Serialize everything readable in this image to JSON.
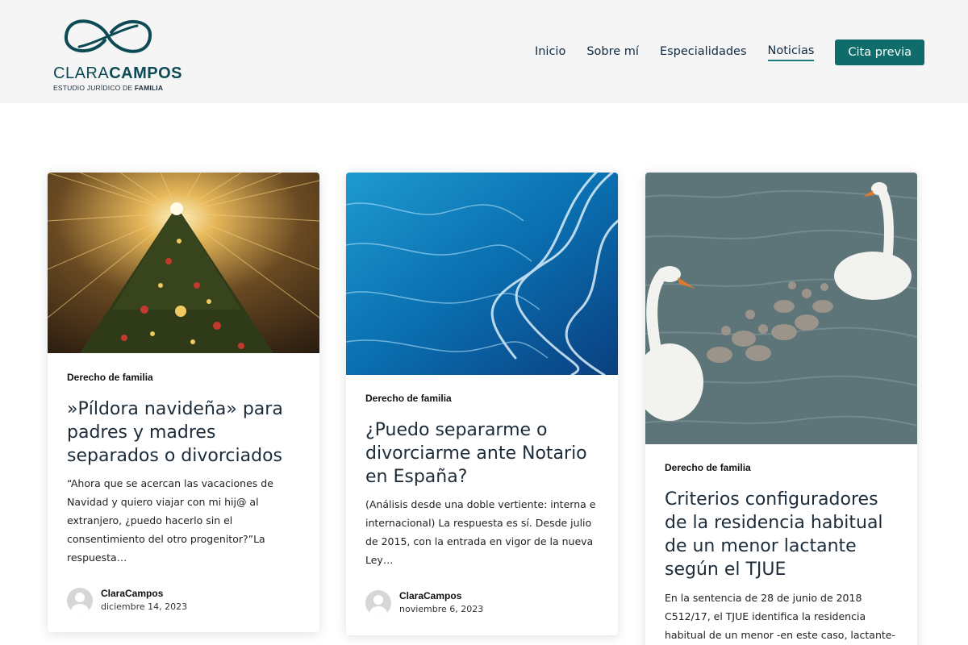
{
  "brand": {
    "name_light": "CLARA",
    "name_bold": "CAMPOS",
    "tagline_light": "ESTUDIO JURÍDICO DE ",
    "tagline_bold": "FAMILIA",
    "color": "#0d4a55"
  },
  "nav": {
    "items": [
      {
        "label": "Inicio"
      },
      {
        "label": "Sobre mí"
      },
      {
        "label": "Especialidades"
      },
      {
        "label": "Noticias"
      }
    ],
    "active": "Noticias",
    "cta_label": "Cita previa",
    "cta_color": "#106b6b"
  },
  "posts": [
    {
      "image": "christmas-tree-lights",
      "category": "Derecho de familia",
      "title": "»Píldora navideña» para padres y madres separados o divorciados",
      "excerpt": "“Ahora que se acercan las vacaciones de Navidad y quiero viajar con mi hij@ al extranjero, ¿puedo hacerlo sin el consentimiento del otro progenitor?”La respuesta…",
      "author": "ClaraCampos",
      "date": "diciembre 14, 2023"
    },
    {
      "image": "ocean-waves",
      "category": "Derecho de familia",
      "title": "¿Puedo separarme o divorciarme ante Notario en España?",
      "excerpt": "(Análisis desde una doble vertiente: interna e internacional) La respuesta es sí. Desde julio de 2015, con la entrada en vigor de la nueva Ley…",
      "author": "ClaraCampos",
      "date": "noviembre 6, 2023"
    },
    {
      "image": "swans-with-cygnets",
      "category": "Derecho de familia",
      "title": "Criterios configuradores de la residencia habitual de un menor lactante según el TJUE",
      "excerpt": "En la sentencia de 28 de junio de 2018 C512/17, el TJUE identifica la residencia habitual de un menor -en este caso, lactante-",
      "author": "",
      "date": ""
    }
  ]
}
